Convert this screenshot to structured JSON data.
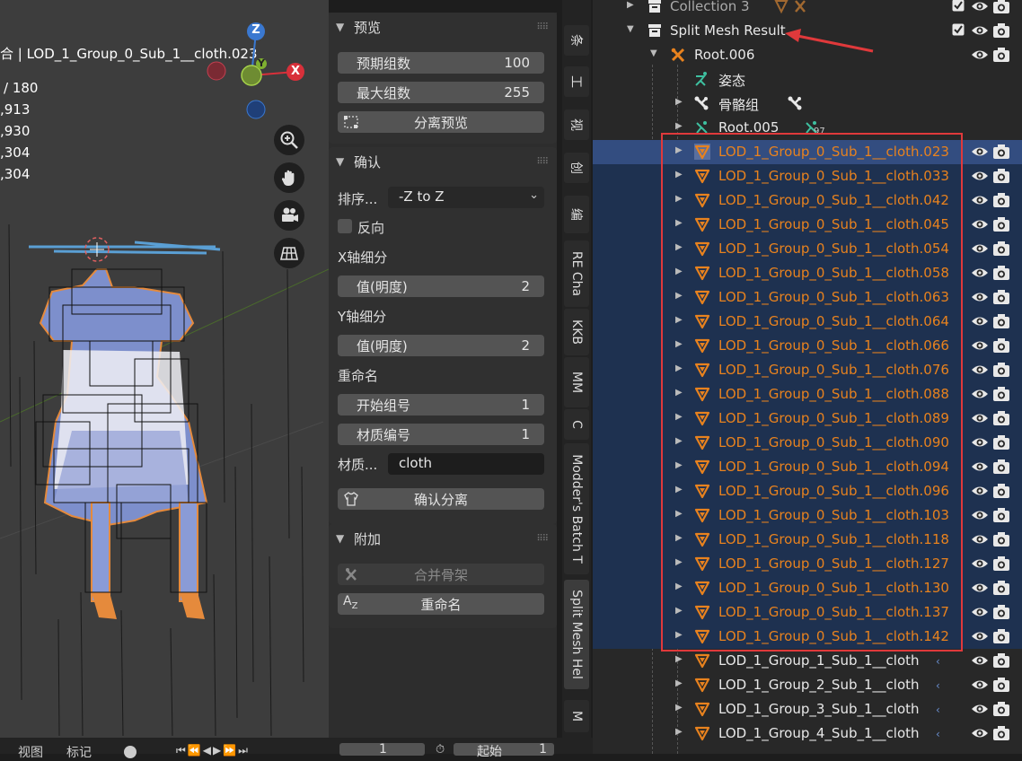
{
  "viewport": {
    "object_title": "合 | LOD_1_Group_0_Sub_1__cloth.023",
    "stats": [
      "/ 180",
      ",913",
      ",930",
      ",304",
      ",304"
    ],
    "gizmo": {
      "z": "Z",
      "x": "X",
      "y": "Y"
    }
  },
  "panel": {
    "preview": {
      "title": "预览",
      "expected_groups": {
        "label": "预期组数",
        "value": "100"
      },
      "max_groups": {
        "label": "最大组数",
        "value": "255"
      },
      "split_preview": "分离预览"
    },
    "confirm": {
      "title": "确认",
      "sort_label": "排序...",
      "sort_value": "-Z to Z",
      "reverse": "反向",
      "x_subdiv": "X轴细分",
      "x_value": {
        "label": "值(明度)",
        "value": "2"
      },
      "y_subdiv": "Y轴细分",
      "y_value": {
        "label": "值(明度)",
        "value": "2"
      },
      "rename": "重命名",
      "start_group": {
        "label": "开始组号",
        "value": "1"
      },
      "material_num": {
        "label": "材质编号",
        "value": "1"
      },
      "material_label": "材质...",
      "material_value": "cloth",
      "confirm_split": "确认分离"
    },
    "extra": {
      "title": "附加",
      "merge_armature": "合并骨架",
      "rename": "重命名"
    }
  },
  "tabs": [
    "条",
    "工",
    "视",
    "创",
    "编",
    "RE Cha",
    "KKB",
    "MM",
    "C",
    "Modder's Batch T",
    "Split Mesh Hel",
    "M"
  ],
  "outliner": {
    "collection3": "Collection 3",
    "split_result": "Split Mesh Result",
    "root006": "Root.006",
    "pose": "姿态",
    "bone_group": "骨骼组",
    "root005": "Root.005",
    "root005_badge": "97",
    "selected_items": [
      "LOD_1_Group_0_Sub_1__cloth.023",
      "LOD_1_Group_0_Sub_1__cloth.033",
      "LOD_1_Group_0_Sub_1__cloth.042",
      "LOD_1_Group_0_Sub_1__cloth.045",
      "LOD_1_Group_0_Sub_1__cloth.054",
      "LOD_1_Group_0_Sub_1__cloth.058",
      "LOD_1_Group_0_Sub_1__cloth.063",
      "LOD_1_Group_0_Sub_1__cloth.064",
      "LOD_1_Group_0_Sub_1__cloth.066",
      "LOD_1_Group_0_Sub_1__cloth.076",
      "LOD_1_Group_0_Sub_1__cloth.088",
      "LOD_1_Group_0_Sub_1__cloth.089",
      "LOD_1_Group_0_Sub_1__cloth.090",
      "LOD_1_Group_0_Sub_1__cloth.094",
      "LOD_1_Group_0_Sub_1__cloth.096",
      "LOD_1_Group_0_Sub_1__cloth.103",
      "LOD_1_Group_0_Sub_1__cloth.118",
      "LOD_1_Group_0_Sub_1__cloth.127",
      "LOD_1_Group_0_Sub_1__cloth.130",
      "LOD_1_Group_0_Sub_1__cloth.137",
      "LOD_1_Group_0_Sub_1__cloth.142"
    ],
    "other_items": [
      "LOD_1_Group_1_Sub_1__cloth",
      "LOD_1_Group_2_Sub_1__cloth",
      "LOD_1_Group_3_Sub_1__cloth",
      "LOD_1_Group_4_Sub_1__cloth"
    ]
  },
  "bottom": {
    "view": "视图",
    "marker": "标记",
    "frame": "1",
    "start_label": "起始",
    "start_value": "1"
  },
  "colors": {
    "selected_text": "#e8821e",
    "highlight_box": "#e0393b",
    "annotation_arrow": "#e0393b"
  }
}
